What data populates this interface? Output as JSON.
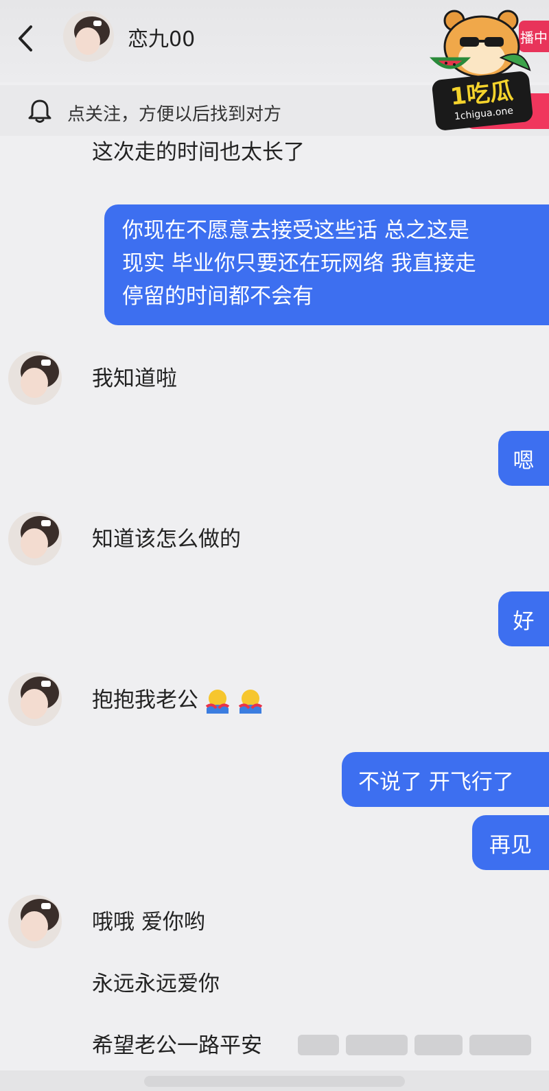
{
  "header": {
    "contact_name": "恋九00",
    "live_tag": "播中"
  },
  "follow_bar": {
    "text": "点关注，方便以后找到对方"
  },
  "watermark": {
    "brand": "1吃瓜",
    "site": "1chigua.one"
  },
  "messages": {
    "m0": "这次走的时间也太长了",
    "m1_line1": "你现在不愿意去接受这些话 总之这是",
    "m1_line2": "现实 毕业你只要还在玩网络 我直接走",
    "m1_line3": "停留的时间都不会有",
    "m2": "我知道啦",
    "m3": "嗯",
    "m4": "知道该怎么做的",
    "m5": "好",
    "m6": "抱抱我老公",
    "m7": "不说了 开飞行了",
    "m8": "再见",
    "m9": "哦哦 爱你哟",
    "m10": "永远永远爱你",
    "m11": "希望老公一路平安"
  },
  "colors": {
    "bubble_sent": "#3d6ff0",
    "background": "#efeff1",
    "follow_button": "#f0365d"
  },
  "icons": {
    "back": "chevron-left-icon",
    "bell": "bell-icon",
    "emoji": "hug-emoji-icon"
  }
}
